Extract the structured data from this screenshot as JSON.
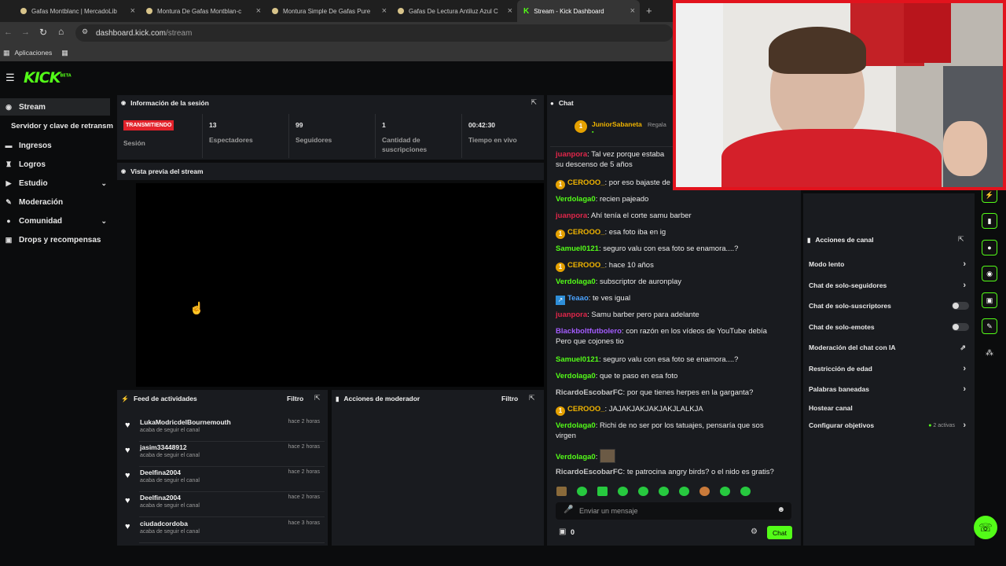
{
  "browser": {
    "tabs": [
      {
        "title": "Gafas Montblanc | MercadoLib"
      },
      {
        "title": "Montura De Gafas Montblan-c"
      },
      {
        "title": "Montura Simple De Gafas Pure"
      },
      {
        "title": "Gafas De Lectura Antiluz Azul C"
      },
      {
        "title": "Stream - Kick Dashboard"
      }
    ],
    "new_tab": "+",
    "url_domain": "dashboard.kick.com",
    "url_path": "/stream",
    "bookmark_apps": "Aplicaciones"
  },
  "header": {
    "logo": "KICK",
    "logo_sup": "BETA"
  },
  "sidebar": {
    "items": [
      {
        "label": "Stream"
      },
      {
        "label": "Servidor y clave de retransm"
      },
      {
        "label": "Ingresos"
      },
      {
        "label": "Logros"
      },
      {
        "label": "Estudio"
      },
      {
        "label": "Moderación"
      },
      {
        "label": "Comunidad"
      },
      {
        "label": "Drops y recompensas"
      }
    ]
  },
  "session": {
    "title": "Información de la sesión",
    "badge": "TRANSMITIENDO",
    "session_label": "Sesión",
    "stats": [
      {
        "value": "13",
        "label": "Espectadores"
      },
      {
        "value": "99",
        "label": "Seguidores"
      },
      {
        "value": "1",
        "label": "Cantidad de suscripciones"
      },
      {
        "value": "00:42:30",
        "label": "Tiempo en vivo"
      }
    ]
  },
  "preview": {
    "title": "Vista previa del stream"
  },
  "feed": {
    "title": "Feed de actividades",
    "filter": "Filtro",
    "rows": [
      {
        "name": "LukaModricdelBournemouth",
        "sub": "acaba de seguir el canal",
        "time": "hace 2 horas"
      },
      {
        "name": "jasim33448912",
        "sub": "acaba de seguir el canal",
        "time": "hace 2 horas"
      },
      {
        "name": "Deelfina2004",
        "sub": "acaba de seguir el canal",
        "time": "hace 2 horas"
      },
      {
        "name": "Deelfina2004",
        "sub": "acaba de seguir el canal",
        "time": "hace 2 horas"
      },
      {
        "name": "ciudadcordoba",
        "sub": "acaba de seguir el canal",
        "time": "hace 3 horas"
      }
    ]
  },
  "mod_actions": {
    "title": "Acciones de moderador",
    "filter": "Filtro"
  },
  "chat": {
    "title": "Chat",
    "pinned_user": "JuniorSabaneta",
    "pinned_action": "Regala",
    "messages": [
      {
        "user": "juanpora",
        "text": "Tal vez porque estaba",
        "extra": "su descenso de 5 años",
        "color": "#e0264a"
      },
      {
        "user": "CEROOO_",
        "text": "por eso bajaste de",
        "color": "#f0b400",
        "badge": "1"
      },
      {
        "user": "Verdolaga0",
        "text": "recien pajeado",
        "color": "#53fc18"
      },
      {
        "user": "juanpora",
        "text": "Ahí tenía el corte samu barber",
        "color": "#e0264a"
      },
      {
        "user": "CEROOO_",
        "text": "esa foto iba en ig",
        "color": "#f0b400",
        "badge": "1"
      },
      {
        "user": "Samuel0121",
        "text": "seguro valu con esa foto se enamora....?",
        "color": "#53fc18"
      },
      {
        "user": "CEROOO_",
        "text": "hace 10 años",
        "color": "#f0b400",
        "badge": "1"
      },
      {
        "user": "Verdolaga0",
        "text": "subscriptor de auronplay",
        "color": "#53fc18"
      },
      {
        "user": "Teaao",
        "text": "te ves igual",
        "color": "#4aa3ff",
        "badge": "↗"
      },
      {
        "user": "juanpora",
        "text": "Samu barber pero para adelante",
        "color": "#e0264a"
      },
      {
        "user": "Blackboltfutbolero",
        "text": "con razón en los vídeos de YouTube debía",
        "extra": "Pero que cojones tio",
        "color": "#a45cff"
      },
      {
        "user": "Samuel0121",
        "text": "seguro valu con esa foto se enamora....?",
        "color": "#53fc18"
      },
      {
        "user": "Verdolaga0",
        "text": "que te paso en esa foto",
        "color": "#53fc18"
      },
      {
        "user": "RicardoEscobarFC",
        "text": "por que tienes herpes en la garganta?",
        "color": "#c7c7c7"
      },
      {
        "user": "CEROOO_",
        "text": "JAJAKJAKJAKJAKJLALKJA",
        "color": "#f0b400",
        "badge": "1"
      },
      {
        "user": "Verdolaga0",
        "text": "Richi de no ser por los tatuajes, pensaría que sos",
        "extra": "virgen",
        "color": "#53fc18"
      },
      {
        "user": "Verdolaga0",
        "text": "",
        "color": "#53fc18",
        "emote": true
      },
      {
        "user": "RicardoEscobarFC",
        "text": "te patrocina angry birds? o el nido es gratis?",
        "color": "#c7c7c7"
      }
    ],
    "input_placeholder": "Enviar un mensaje",
    "count": "0",
    "send": "Chat"
  },
  "channel_actions": {
    "title": "Acciones de canal",
    "items": [
      {
        "label": "Modo lento",
        "control": "chevron"
      },
      {
        "label": "Chat de solo-seguidores",
        "control": "chevron"
      },
      {
        "label": "Chat de solo-suscriptores",
        "control": "toggle"
      },
      {
        "label": "Chat de solo-emotes",
        "control": "toggle"
      },
      {
        "label": "Moderación del chat con IA",
        "control": "external"
      },
      {
        "label": "Restricción de edad",
        "control": "chevron"
      },
      {
        "label": "Palabras baneadas",
        "control": "chevron"
      },
      {
        "label": "Hostear canal",
        "control": "none"
      },
      {
        "label": "Configurar objetivos",
        "control": "chevron",
        "note": "2 activas"
      }
    ]
  },
  "colors": {
    "accent": "#53fc18",
    "live": "#e3222b",
    "panel": "#191b1f",
    "bg": "#0b0c0d"
  }
}
